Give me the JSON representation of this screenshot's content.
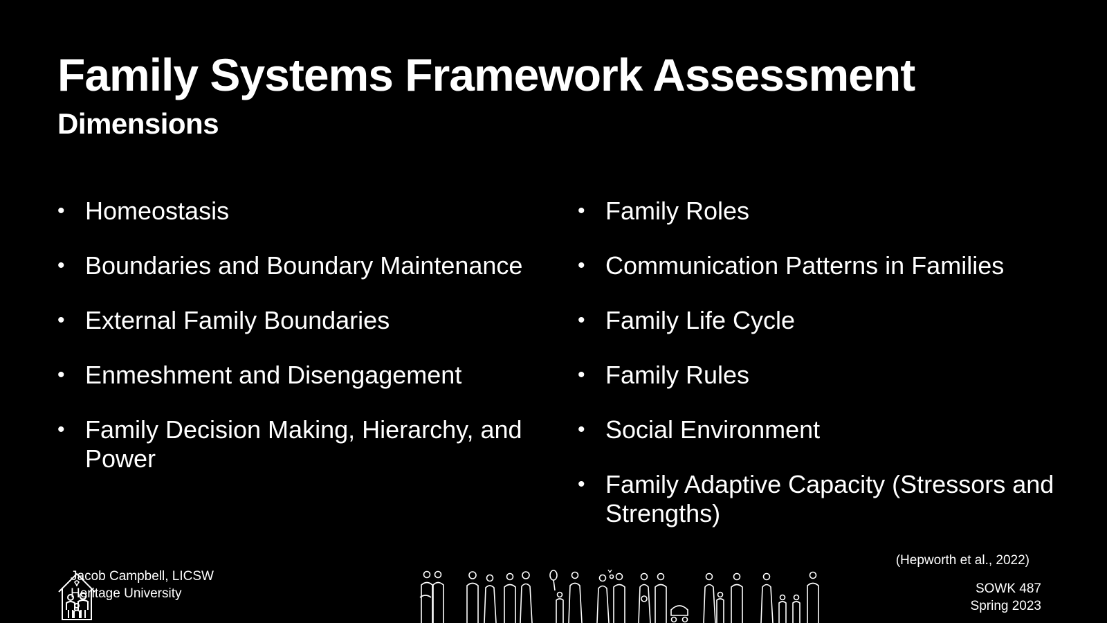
{
  "slide": {
    "title": "Family Systems Framework Assessment",
    "subtitle": "Dimensions",
    "bullet_glyph": "•",
    "left_items": [
      "Homeostasis",
      "Boundaries and Boundary Maintenance",
      "External Family Boundaries",
      "Enmeshment and Disengagement",
      "Family Decision Making, Hierarchy, and Power"
    ],
    "right_items": [
      "Family Roles",
      "Communication Patterns in Families",
      "Family Life Cycle",
      "Family Rules",
      "Social Environment",
      "Family Adaptive Capacity (Stressors and Strengths)"
    ],
    "citation": "(Hepworth et al., 2022)"
  },
  "footer": {
    "author_name": "Jacob Campbell, LICSW",
    "institution": "Heritage University",
    "course": "SOWK 487",
    "term": "Spring 2023",
    "logo_icon": "family-house-icon",
    "illustration_icon": "family-silhouettes-icon"
  },
  "colors": {
    "background": "#000000",
    "text": "#ffffff"
  }
}
